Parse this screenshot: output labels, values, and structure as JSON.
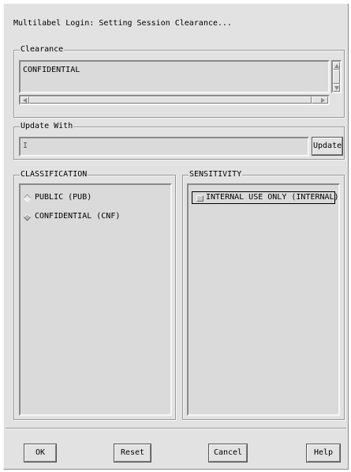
{
  "window": {
    "title": "Multilabel Login: Setting Session Clearance..."
  },
  "clearance": {
    "legend": "Clearance",
    "value": "CONFIDENTIAL"
  },
  "update_with": {
    "legend": "Update With",
    "value": "",
    "button_label": "Update"
  },
  "classification": {
    "legend": "CLASSIFICATION",
    "options": [
      {
        "label": "PUBLIC (PUB)",
        "selected": false
      },
      {
        "label": "CONFIDENTIAL (CNF)",
        "selected": true
      }
    ]
  },
  "sensitivity": {
    "legend": "SENSITIVITY",
    "items": [
      {
        "label": "INTERNAL USE ONLY (INTERNAL)",
        "checked": false
      }
    ]
  },
  "footer": {
    "ok_label": "OK",
    "reset_label": "Reset",
    "cancel_label": "Cancel",
    "help_label": "Help"
  }
}
